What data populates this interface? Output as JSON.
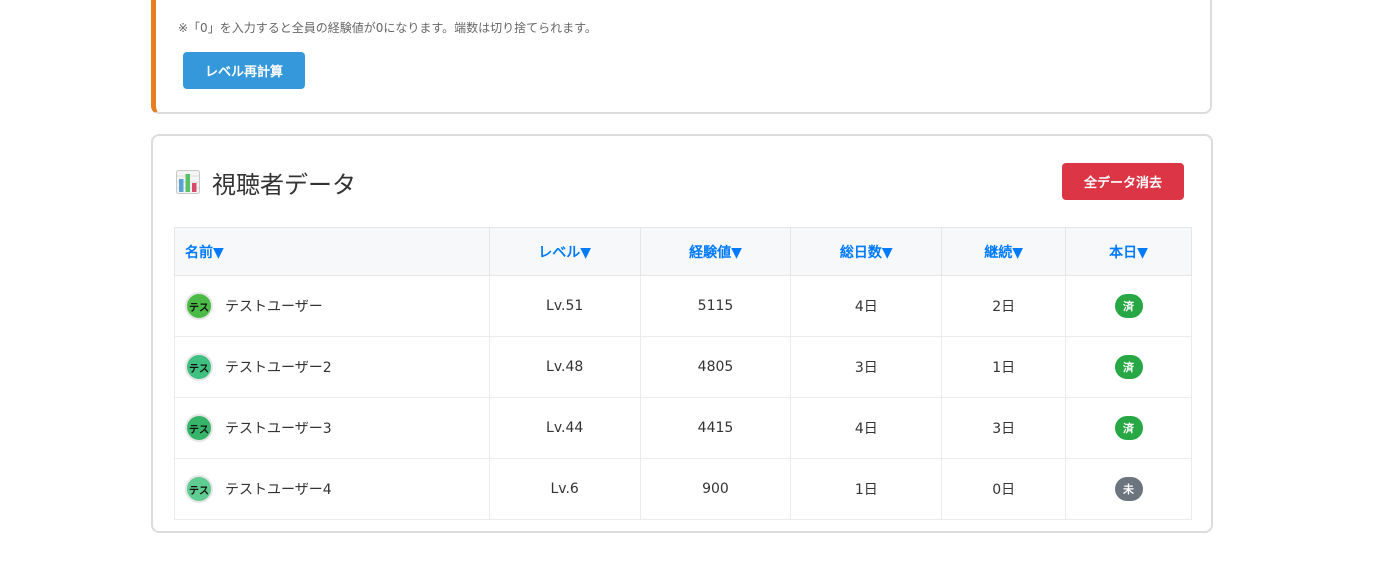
{
  "settings": {
    "note": "※「0」を入力すると全員の経験値が0になります。端数は切り捨てられます。",
    "recalc_button": "レベル再計算",
    "accent_color": "#e67e22",
    "button_color": "#3498db"
  },
  "viewers": {
    "title": "視聴者データ",
    "title_icon": "bar-chart-icon",
    "clear_button": "全データ消去",
    "clear_color": "#dc3545",
    "columns": {
      "name": "名前▼",
      "level": "レベル▼",
      "exp": "経験値▼",
      "total_days": "総日数▼",
      "streak": "継続▼",
      "today": "本日▼"
    },
    "rows": [
      {
        "avatar": "テス",
        "avatar_color": "#4cba47",
        "name": "テストユーザー",
        "level": "Lv.51",
        "exp": "5115",
        "total_days": "4日",
        "streak": "2日",
        "today": "済",
        "today_color": "#28a745"
      },
      {
        "avatar": "テス",
        "avatar_color": "#40c080",
        "name": "テストユーザー2",
        "level": "Lv.48",
        "exp": "4805",
        "total_days": "3日",
        "streak": "1日",
        "today": "済",
        "today_color": "#28a745"
      },
      {
        "avatar": "テス",
        "avatar_color": "#36b56a",
        "name": "テストユーザー3",
        "level": "Lv.44",
        "exp": "4415",
        "total_days": "4日",
        "streak": "3日",
        "today": "済",
        "today_color": "#28a745"
      },
      {
        "avatar": "テス",
        "avatar_color": "#5fcd91",
        "name": "テストユーザー4",
        "level": "Lv.6",
        "exp": "900",
        "total_days": "1日",
        "streak": "0日",
        "today": "未",
        "today_color": "#6c757d"
      }
    ]
  }
}
